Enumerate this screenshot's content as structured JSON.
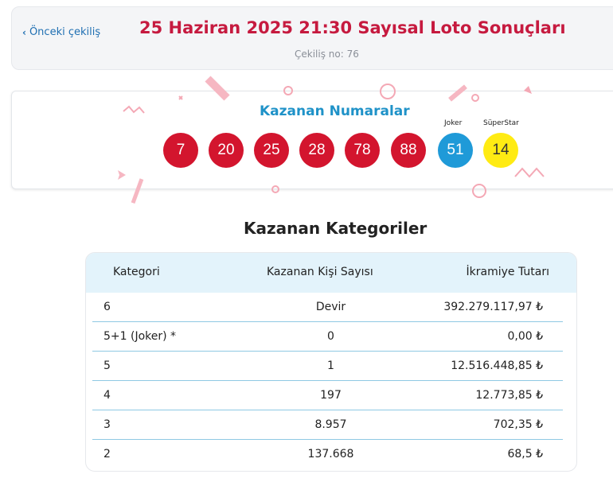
{
  "header": {
    "back_label": "Önceki çekiliş",
    "title": "25 Haziran 2025 21:30 Sayısal Loto Sonuçları",
    "draw_number": "Çekiliş no: 76"
  },
  "winning": {
    "title": "Kazanan Numaralar",
    "numbers": [
      "7",
      "20",
      "25",
      "28",
      "78",
      "88"
    ],
    "joker_label": "Joker",
    "joker": "51",
    "superstar_label": "SüperStar",
    "superstar": "14",
    "colors": {
      "main": "#d3152e",
      "joker": "#1f9ad8",
      "superstar": "#ffeb13"
    }
  },
  "categories": {
    "title": "Kazanan Kategoriler",
    "headers": [
      "Kategori",
      "Kazanan Kişi Sayısı",
      "İkramiye Tutarı"
    ],
    "rows": [
      [
        "6",
        "Devir",
        "392.279.117,97 ₺"
      ],
      [
        "5+1 (Joker) *",
        "0",
        "0,00 ₺"
      ],
      [
        "5",
        "1",
        "12.516.448,85 ₺"
      ],
      [
        "4",
        "197",
        "12.773,85 ₺"
      ],
      [
        "3",
        "8.957",
        "702,35 ₺"
      ],
      [
        "2",
        "137.668",
        "68,5 ₺"
      ]
    ]
  }
}
